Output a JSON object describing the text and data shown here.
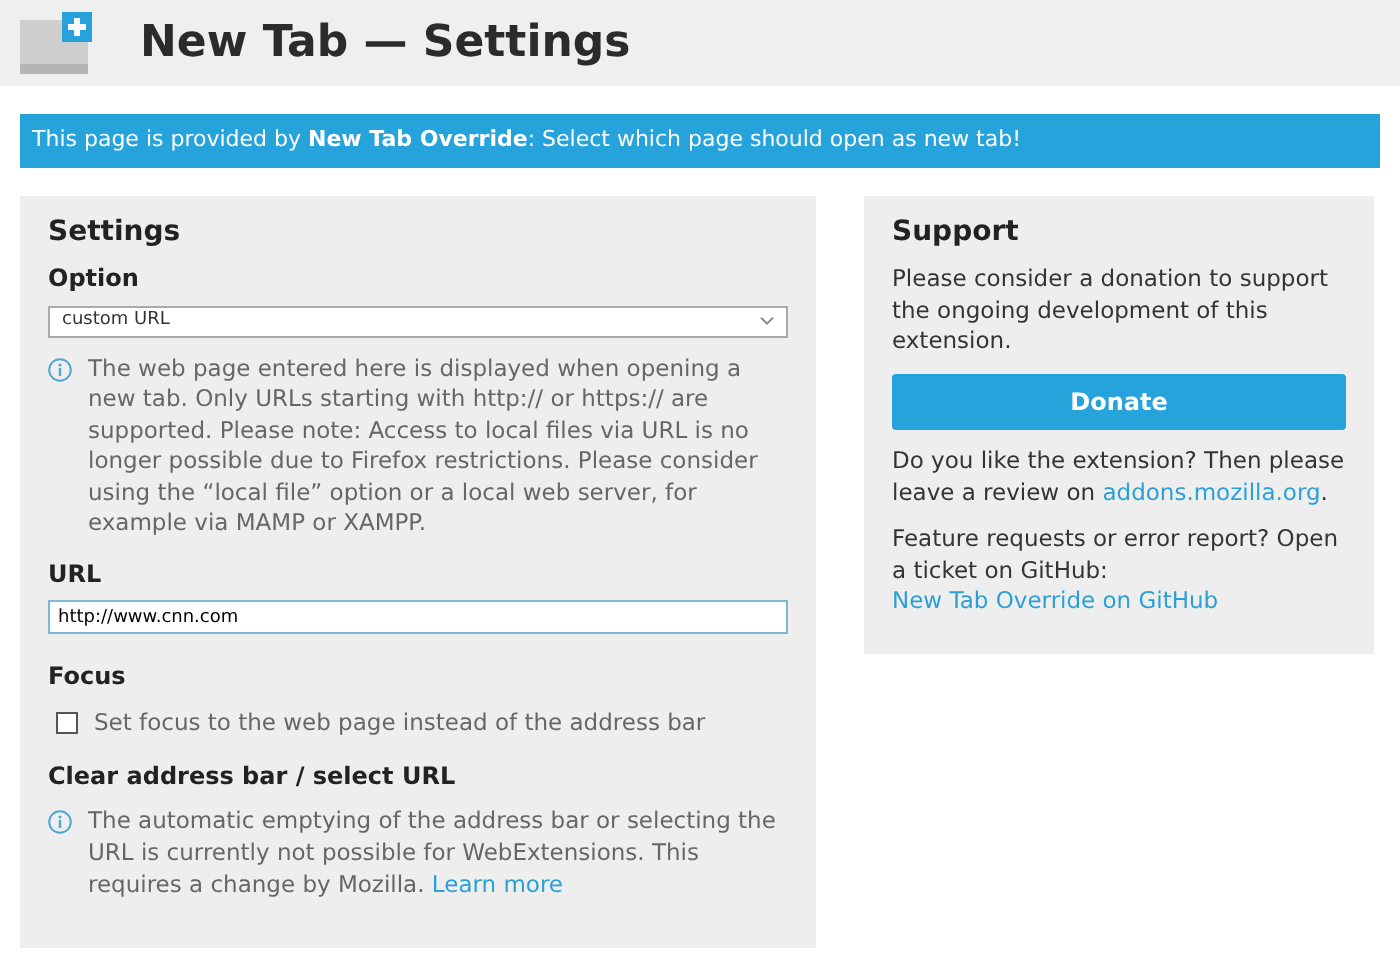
{
  "header": {
    "title": "New Tab — Settings"
  },
  "banner": {
    "text": "This page is provided by **New Tab Override**: Select which page should open as new tab!"
  },
  "settings": {
    "title": "Settings",
    "option": {
      "heading": "Option",
      "value": "custom URL",
      "note": "The web page entered here is displayed when opening a new tab. Only URLs starting with http:// or https:// are supported. Please note: Access to local files via URL is no longer possible due to Firefox restrictions. Please consider using the “local file” option or a local web server, for example via MAMP or XAMPP."
    },
    "url": {
      "heading": "URL",
      "value": "http://www.cnn.com"
    },
    "focus": {
      "heading": "Focus",
      "label": "Set focus to the web page instead of the address bar",
      "checked": false
    },
    "clear": {
      "heading": "Clear address bar / select URL",
      "note": "The automatic emptying of the address bar or selecting the URL is currently not possible for WebExtensions. This requires a change by Mozilla. ",
      "link": "Learn more"
    }
  },
  "support": {
    "title": "Support",
    "text": "Please consider a donation to support the ongoing development of this extension.",
    "button": "Donate",
    "review": {
      "text": "Do you like the extension? Then please leave a review on ",
      "link": "addons.mozilla.org",
      "after": "."
    },
    "feature": {
      "text": "Feature requests or error report? Open a ticket on GitHub:",
      "link": "New Tab Override on GitHub"
    }
  }
}
